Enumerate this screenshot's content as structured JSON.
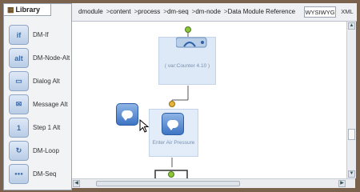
{
  "library": {
    "tab_label": "Library",
    "items": [
      {
        "label": "DM-If",
        "icon": "if-icon",
        "glyph": "if"
      },
      {
        "label": "DM-Node-Alt",
        "icon": "node-alt-icon",
        "glyph": "alt"
      },
      {
        "label": "Dialog Alt",
        "icon": "dialog-icon",
        "glyph": "▭"
      },
      {
        "label": "Message Alt",
        "icon": "message-icon",
        "glyph": "✉"
      },
      {
        "label": "Step 1 Alt",
        "icon": "step-icon",
        "glyph": "1"
      },
      {
        "label": "DM-Loop",
        "icon": "loop-icon",
        "glyph": "↻"
      },
      {
        "label": "DM-Seq",
        "icon": "sequence-icon",
        "glyph": "●●●"
      }
    ]
  },
  "breadcrumb": {
    "items": [
      "dmodule",
      "content",
      "process",
      "dm-seq",
      "dm-node",
      "Data Module Reference"
    ],
    "separator": ">"
  },
  "view_toggle": {
    "wysiwyg_label": "WYSIWYG",
    "xml_label": "XML"
  },
  "diagram": {
    "condition_label": "( var:Counter 4.10 )",
    "message_label": "Enter Air Pressure"
  },
  "colors": {
    "frame": "#7a624d",
    "accent": "#3d74c4",
    "connector_yellow": "#e6b43c",
    "connector_green": "#8cc43a"
  }
}
